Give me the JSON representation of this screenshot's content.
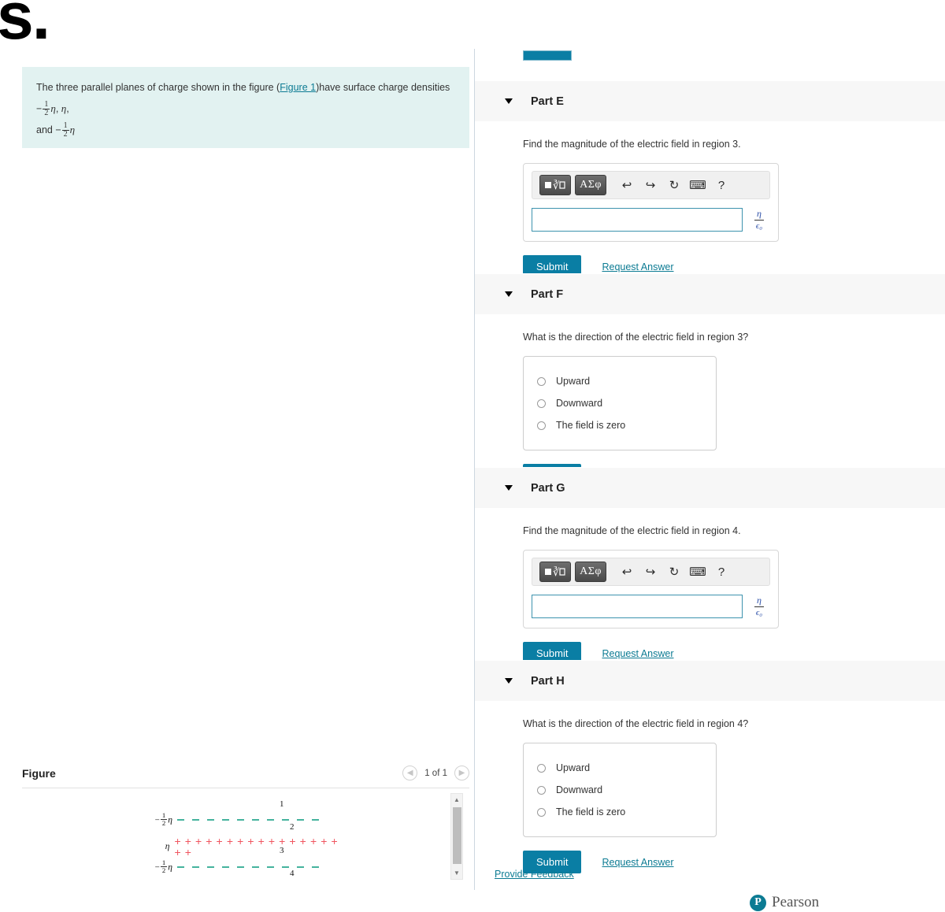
{
  "logo_text": "s.",
  "problem": {
    "text_part1": "The three parallel planes of charge shown in the figure (",
    "figure_link": "Figure 1",
    "text_part2": ")have surface charge densities ",
    "frac_num": "1",
    "frac_den": "2",
    "eta": "η",
    "text_part3": ", ",
    "text_part4": " and ",
    "minus": "−"
  },
  "figure": {
    "title": "Figure",
    "counter": "1 of 1",
    "prev_icon": "chevron-left-icon",
    "next_icon": "chevron-right-icon",
    "planes": [
      {
        "label_minus": "−",
        "label_frac_num": "1",
        "label_frac_den": "2",
        "label_eta": "η",
        "type": "negative"
      },
      {
        "label_minus": "",
        "label_frac_num": "",
        "label_frac_den": "",
        "label_eta": "η",
        "type": "positive"
      },
      {
        "label_minus": "−",
        "label_frac_num": "1",
        "label_frac_den": "2",
        "label_eta": "η",
        "type": "negative"
      }
    ],
    "plus_row": "+ + + + + + + + + + + + + + + + + +",
    "regions": [
      "1",
      "2",
      "3",
      "4"
    ],
    "colors": {
      "negative_plane": "#45b39d",
      "positive_plane": "#f0555f"
    }
  },
  "toolbar": {
    "template_icon": "math-template-icon",
    "greek_label": "ΑΣφ",
    "undo_icon": "undo-icon",
    "redo_icon": "redo-icon",
    "reset_icon": "reset-icon",
    "keyboard_icon": "keyboard-icon",
    "help_icon": "?"
  },
  "answer_unit": {
    "numerator": "η",
    "denominator": "ϵ₀"
  },
  "labels": {
    "submit": "Submit",
    "request_answer": "Request Answer",
    "answer_placeholder": ""
  },
  "parts": [
    {
      "title": "Part E",
      "question": "Find the magnitude of the electric field in region 3.",
      "kind": "numeric"
    },
    {
      "title": "Part F",
      "question": "What is the direction of the electric field in region 3?",
      "kind": "choice",
      "choices": [
        "Upward",
        "Downward",
        "The field is zero"
      ]
    },
    {
      "title": "Part G",
      "question": "Find the magnitude of the electric field in region 4.",
      "kind": "numeric"
    },
    {
      "title": "Part H",
      "question": "What is the direction of the electric field in region 4?",
      "kind": "choice",
      "choices": [
        "Upward",
        "Downward",
        "The field is zero"
      ]
    }
  ],
  "footer": {
    "provide_feedback": "Provide Feedback",
    "brand": "Pearson",
    "brand_mark": "P"
  },
  "colors": {
    "accent": "#0a7ea4",
    "link": "#0c7b93",
    "problem_bg": "#e2f2f1",
    "part_header_bg": "#f7f7f7"
  }
}
